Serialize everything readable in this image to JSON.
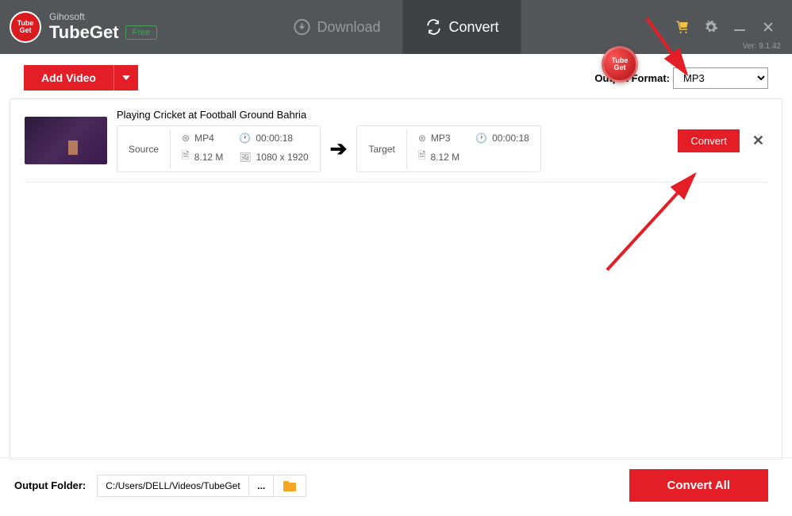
{
  "brand": {
    "company": "Gihosoft",
    "product": "TubeGet",
    "badge": "Free",
    "logo_text": "Tube\nGet"
  },
  "version": "Ver: 9.1.42",
  "nav": {
    "download": "Download",
    "convert": "Convert"
  },
  "toolbar": {
    "add_video": "Add Video",
    "output_format_label": "Output Format:",
    "output_format_value": "MP3"
  },
  "float_badge": "Tube\nGet",
  "item": {
    "title": "Playing Cricket at Football Ground Bahria",
    "source_label": "Source",
    "target_label": "Target",
    "source": {
      "format": "MP4",
      "duration": "00:00:18",
      "size": "8.12 M",
      "resolution": "1080 x 1920"
    },
    "target": {
      "format": "MP3",
      "duration": "00:00:18",
      "size": "8.12 M"
    },
    "convert_btn": "Convert"
  },
  "footer": {
    "output_folder_label": "Output Folder:",
    "output_folder_path": "C:/Users/DELL/Videos/TubeGet",
    "more": "...",
    "convert_all": "Convert All"
  }
}
